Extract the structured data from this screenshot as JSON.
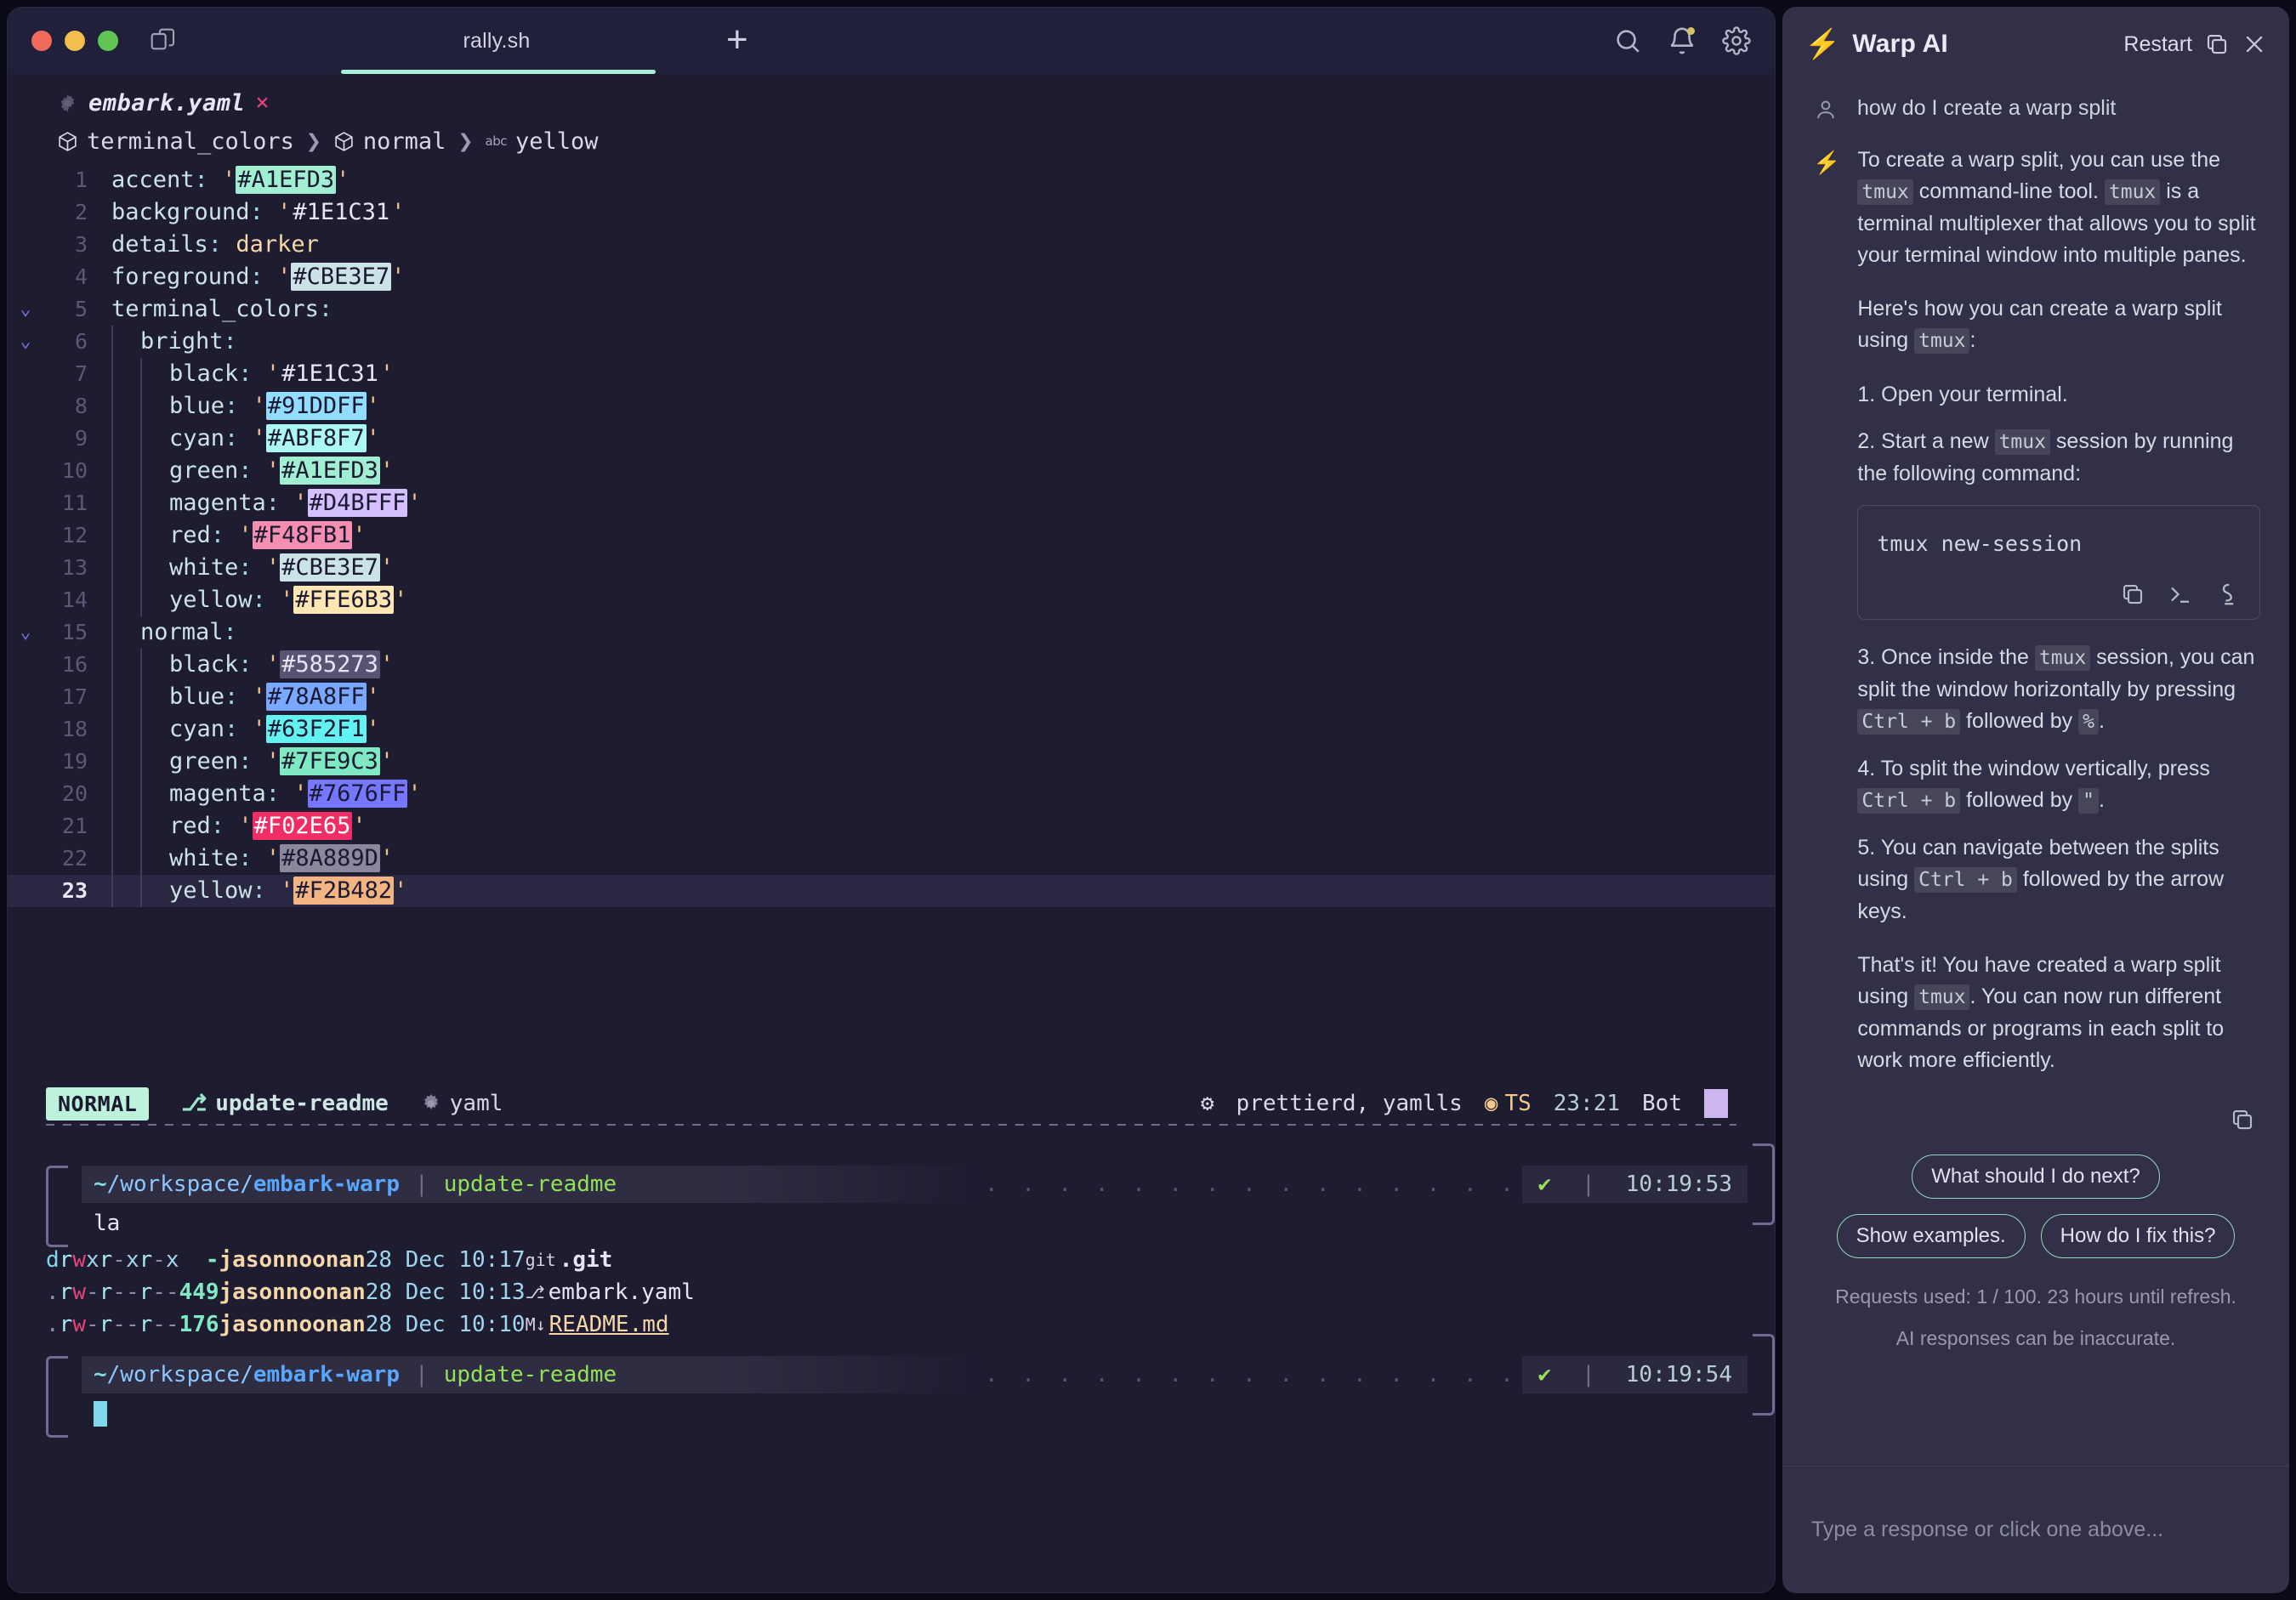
{
  "window": {
    "tab_title": "rally.sh",
    "new_tab_label": "+",
    "icons": {
      "panes": "panes-icon",
      "search": "search-icon",
      "bell": "bell-icon",
      "settings": "gear-icon"
    }
  },
  "editor": {
    "file_name": "embark.yaml",
    "close_label": "×",
    "breadcrumb": [
      "terminal_colors",
      "normal",
      "yellow"
    ],
    "lines": [
      {
        "n": "1",
        "fold": "",
        "depth": 0,
        "key": "accent",
        "quoted": true,
        "value": "#A1EFD3",
        "swatch": "#A1EFD3",
        "text_color": "#1b1930"
      },
      {
        "n": "2",
        "fold": "",
        "depth": 0,
        "key": "background",
        "quoted": true,
        "value": "#1E1C31",
        "swatch": "#1E1C31",
        "text_color": "#e7e5f3"
      },
      {
        "n": "3",
        "fold": "",
        "depth": 0,
        "key": "details",
        "quoted": false,
        "value": "darker",
        "swatch": "",
        "text_color": ""
      },
      {
        "n": "4",
        "fold": "",
        "depth": 0,
        "key": "foreground",
        "quoted": true,
        "value": "#CBE3E7",
        "swatch": "#CBE3E7",
        "text_color": "#1b1930"
      },
      {
        "n": "5",
        "fold": "v",
        "depth": 0,
        "key": "terminal_colors",
        "quoted": false,
        "value": "",
        "swatch": "",
        "text_color": ""
      },
      {
        "n": "6",
        "fold": "v",
        "depth": 1,
        "key": "bright",
        "quoted": false,
        "value": "",
        "swatch": "",
        "text_color": ""
      },
      {
        "n": "7",
        "fold": "",
        "depth": 2,
        "key": "black",
        "quoted": true,
        "value": "#1E1C31",
        "swatch": "#1E1C31",
        "text_color": "#e7e5f3"
      },
      {
        "n": "8",
        "fold": "",
        "depth": 2,
        "key": "blue",
        "quoted": true,
        "value": "#91DDFF",
        "swatch": "#91DDFF",
        "text_color": "#1b1930"
      },
      {
        "n": "9",
        "fold": "",
        "depth": 2,
        "key": "cyan",
        "quoted": true,
        "value": "#ABF8F7",
        "swatch": "#ABF8F7",
        "text_color": "#1b1930"
      },
      {
        "n": "10",
        "fold": "",
        "depth": 2,
        "key": "green",
        "quoted": true,
        "value": "#A1EFD3",
        "swatch": "#A1EFD3",
        "text_color": "#1b1930"
      },
      {
        "n": "11",
        "fold": "",
        "depth": 2,
        "key": "magenta",
        "quoted": true,
        "value": "#D4BFFF",
        "swatch": "#D4BFFF",
        "text_color": "#1b1930"
      },
      {
        "n": "12",
        "fold": "",
        "depth": 2,
        "key": "red",
        "quoted": true,
        "value": "#F48FB1",
        "swatch": "#F48FB1",
        "text_color": "#1b1930"
      },
      {
        "n": "13",
        "fold": "",
        "depth": 2,
        "key": "white",
        "quoted": true,
        "value": "#CBE3E7",
        "swatch": "#CBE3E7",
        "text_color": "#1b1930"
      },
      {
        "n": "14",
        "fold": "",
        "depth": 2,
        "key": "yellow",
        "quoted": true,
        "value": "#FFE6B3",
        "swatch": "#FFE6B3",
        "text_color": "#1b1930"
      },
      {
        "n": "15",
        "fold": "v",
        "depth": 1,
        "key": "normal",
        "quoted": false,
        "value": "",
        "swatch": "",
        "text_color": ""
      },
      {
        "n": "16",
        "fold": "",
        "depth": 2,
        "key": "black",
        "quoted": true,
        "value": "#585273",
        "swatch": "#585273",
        "text_color": "#e7e5f3"
      },
      {
        "n": "17",
        "fold": "",
        "depth": 2,
        "key": "blue",
        "quoted": true,
        "value": "#78A8FF",
        "swatch": "#78A8FF",
        "text_color": "#1b1930"
      },
      {
        "n": "18",
        "fold": "",
        "depth": 2,
        "key": "cyan",
        "quoted": true,
        "value": "#63F2F1",
        "swatch": "#63F2F1",
        "text_color": "#1b1930"
      },
      {
        "n": "19",
        "fold": "",
        "depth": 2,
        "key": "green",
        "quoted": true,
        "value": "#7FE9C3",
        "swatch": "#7FE9C3",
        "text_color": "#1b1930"
      },
      {
        "n": "20",
        "fold": "",
        "depth": 2,
        "key": "magenta",
        "quoted": true,
        "value": "#7676FF",
        "swatch": "#7676FF",
        "text_color": "#1b1930"
      },
      {
        "n": "21",
        "fold": "",
        "depth": 2,
        "key": "red",
        "quoted": true,
        "value": "#F02E65",
        "swatch": "#F02E65",
        "text_color": "#ffffff"
      },
      {
        "n": "22",
        "fold": "",
        "depth": 2,
        "key": "white",
        "quoted": true,
        "value": "#8A889D",
        "swatch": "#8A889D",
        "text_color": "#1b1930"
      },
      {
        "n": "23",
        "fold": "",
        "depth": 2,
        "key": "yellow",
        "quoted": true,
        "value": "#F2B482",
        "swatch": "#F2B482",
        "text_color": "#1b1930",
        "current": true
      }
    ]
  },
  "statusbar": {
    "mode": "NORMAL",
    "branch": "update-readme",
    "filetype": "yaml",
    "lsp": "prettierd, yamlls",
    "ts": "TS",
    "time": "23:21",
    "user": "Bot"
  },
  "terminal": {
    "blocks": [
      {
        "path_tilde": "~",
        "path_mid": "/workspace/",
        "path_bold": "embark-warp",
        "branch": "update-readme",
        "exit_ok": "✔",
        "time": "10:19:53",
        "command": "la",
        "rows": [
          {
            "perm": "drwxr-xr-x",
            "size": "-",
            "user": "jasonnoonan",
            "date": "28 Dec",
            "time": "10:17",
            "icon": "git",
            "name": ".git",
            "style": "git"
          },
          {
            "perm": ".rw-r--r--",
            "size": "449",
            "user": "jasonnoonan",
            "date": "28 Dec",
            "time": "10:13",
            "icon": "yaml",
            "name": "embark.yaml",
            "style": "plain"
          },
          {
            "perm": ".rw-r--r--",
            "size": "176",
            "user": "jasonnoonan",
            "date": "28 Dec",
            "time": "10:10",
            "icon": "md",
            "name": "README.md",
            "style": "md"
          }
        ]
      },
      {
        "path_tilde": "~",
        "path_mid": "/workspace/",
        "path_bold": "embark-warp",
        "branch": "update-readme",
        "exit_ok": "✔",
        "time": "10:19:54",
        "command": "",
        "rows": []
      }
    ]
  },
  "ai": {
    "title": "Warp AI",
    "restart_label": "Restart",
    "user_message": "how do I create a warp split",
    "paragraphs": [
      "To create a warp split, you can use the tmux command-line tool. tmux is a terminal multiplexer that allows you to split your terminal window into multiple panes.",
      "Here's how you can create a warp split using tmux:"
    ],
    "steps_before": [
      "1. Open your terminal.",
      "2. Start a new tmux session by running the following command:"
    ],
    "code_command": "tmux new-session",
    "steps_after": [
      "3. Once inside the tmux session, you can split the window horizontally by pressing Ctrl + b followed by %.",
      "4. To split the window vertically, press Ctrl + b followed by \".",
      "5. You can navigate between the splits using Ctrl + b followed by the arrow keys."
    ],
    "closing": "That's it! You have created a warp split using tmux. You can now run different commands or programs in each split to work more efficiently.",
    "chips": [
      "What should I do next?",
      "Show examples.",
      "How do I fix this?"
    ],
    "quota": "Requests used: 1 / 100.  23 hours until refresh.",
    "disclaimer": "AI responses can be inaccurate.",
    "input_placeholder": "Type a response or click one above..."
  }
}
